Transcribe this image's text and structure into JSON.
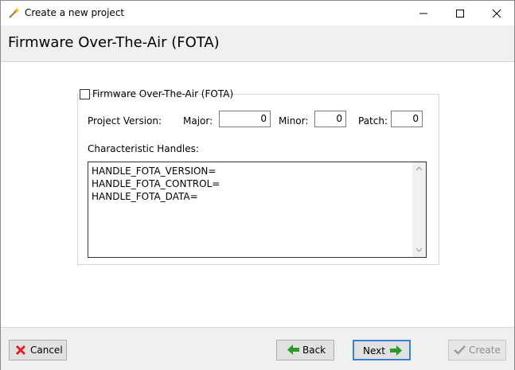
{
  "window": {
    "title": "Create a new project",
    "icon": "wand-icon"
  },
  "header": {
    "title": "Firmware Over-The-Air (FOTA)"
  },
  "fota_group": {
    "checkbox_label": "Firmware Over-The-Air (FOTA)",
    "checked": false,
    "project_version_label": "Project Version:",
    "major_label": "Major:",
    "major_value": "0",
    "minor_label": "Minor:",
    "minor_value": "0",
    "patch_label": "Patch:",
    "patch_value": "0",
    "handles_label": "Characteristic Handles:",
    "handles_lines": [
      "HANDLE_FOTA_VERSION=",
      "HANDLE_FOTA_CONTROL=",
      "HANDLE_FOTA_DATA="
    ]
  },
  "footer": {
    "cancel_label": "Cancel",
    "back_label": "Back",
    "next_label": "Next",
    "create_label": "Create"
  },
  "colors": {
    "cancel_icon": "#d8262b",
    "arrow_icon": "#2e9a2e",
    "focus_border": "#3b7fd4"
  }
}
